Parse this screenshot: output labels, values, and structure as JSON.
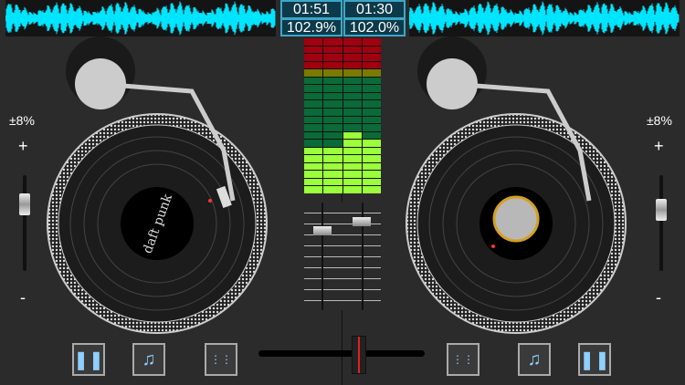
{
  "deck_left": {
    "time": "01:51",
    "pitch_percent": "102.9%",
    "pitch_range": "±8%",
    "plus": "+",
    "minus": "-",
    "label_art": "daft punk"
  },
  "deck_right": {
    "time": "01:30",
    "pitch_percent": "102.0%",
    "pitch_range": "±8%",
    "plus": "+",
    "minus": "-"
  },
  "meter": {
    "rows": 20,
    "levels": [
      6,
      6,
      8,
      7
    ]
  },
  "crossfader": {
    "position": 0.6
  },
  "colors": {
    "waveform": "#00e5ff",
    "accent": "#3aa8c8"
  },
  "icons": [
    "pause-icon",
    "add-music-icon",
    "mixer-icon"
  ]
}
